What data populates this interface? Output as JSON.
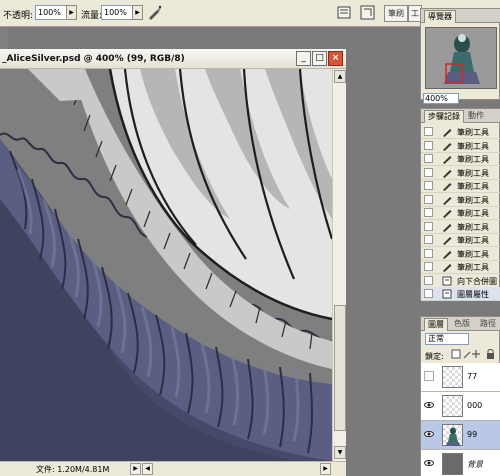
{
  "options_bar": {
    "opacity_label": "不透明:",
    "opacity_value": "100%",
    "flow_label": "流量:",
    "flow_value": "100%",
    "tab_labels": [
      "筆刷",
      "工具"
    ]
  },
  "document": {
    "title": "_AliceSilver.psd @ 400% (99, RGB/8)",
    "status": "文件: 1.20M/4.81M"
  },
  "navigator": {
    "tab_labels": [
      "導覽器"
    ],
    "zoom": "400%"
  },
  "history": {
    "tab_labels": [
      "步驟記錄",
      "動作"
    ],
    "items": [
      {
        "label": "筆刷工具"
      },
      {
        "label": "筆刷工具"
      },
      {
        "label": "筆刷工具"
      },
      {
        "label": "筆刷工具"
      },
      {
        "label": "筆刷工具"
      },
      {
        "label": "筆刷工具"
      },
      {
        "label": "筆刷工具"
      },
      {
        "label": "筆刷工具"
      },
      {
        "label": "筆刷工具"
      },
      {
        "label": "筆刷工具"
      },
      {
        "label": "筆刷工具"
      },
      {
        "label": "向下合併圖"
      },
      {
        "label": "圖層屬性"
      }
    ]
  },
  "layers": {
    "tab_labels": [
      "圖層",
      "色版",
      "路徑"
    ],
    "blend_mode": "正常",
    "lock_label": "鎖定:",
    "rows": [
      {
        "name": "77",
        "visible": false
      },
      {
        "name": "000",
        "visible": true
      },
      {
        "name": "99",
        "visible": true,
        "active": true
      },
      {
        "name": "背景",
        "visible": true
      }
    ]
  },
  "colors": {
    "skirt_blue": "#5a5e82",
    "skirt_blue_dark": "#3a3d5a",
    "skirt_white": "#dcdcdc",
    "canvas_bg": "#7f7f7f",
    "ui_face": "#ece9d8"
  }
}
